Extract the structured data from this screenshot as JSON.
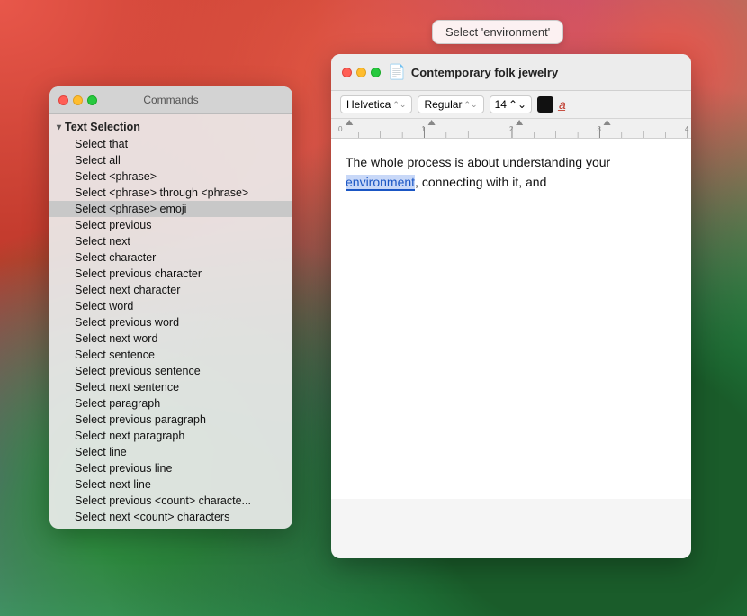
{
  "wallpaper": {},
  "tooltip": {
    "text": "Select 'environment'"
  },
  "commands_panel": {
    "title": "Commands",
    "traffic_lights": {
      "close": "close",
      "minimize": "minimize",
      "maximize": "maximize"
    },
    "section": {
      "label": "Text Selection",
      "chevron": "▾",
      "items": [
        {
          "label": "Select that",
          "highlighted": false
        },
        {
          "label": "Select all",
          "highlighted": false
        },
        {
          "label": "Select <phrase>",
          "highlighted": false
        },
        {
          "label": "Select <phrase> through <phrase>",
          "highlighted": false
        },
        {
          "label": "Select <phrase> emoji",
          "highlighted": true
        },
        {
          "label": "Select previous",
          "highlighted": false
        },
        {
          "label": "Select next",
          "highlighted": false
        },
        {
          "label": "Select character",
          "highlighted": false
        },
        {
          "label": "Select previous character",
          "highlighted": false
        },
        {
          "label": "Select next character",
          "highlighted": false
        },
        {
          "label": "Select word",
          "highlighted": false
        },
        {
          "label": "Select previous word",
          "highlighted": false
        },
        {
          "label": "Select next word",
          "highlighted": false
        },
        {
          "label": "Select sentence",
          "highlighted": false
        },
        {
          "label": "Select previous sentence",
          "highlighted": false
        },
        {
          "label": "Select next sentence",
          "highlighted": false
        },
        {
          "label": "Select paragraph",
          "highlighted": false
        },
        {
          "label": "Select previous paragraph",
          "highlighted": false
        },
        {
          "label": "Select next paragraph",
          "highlighted": false
        },
        {
          "label": "Select line",
          "highlighted": false
        },
        {
          "label": "Select previous line",
          "highlighted": false
        },
        {
          "label": "Select next line",
          "highlighted": false
        },
        {
          "label": "Select previous <count> characte...",
          "highlighted": false
        },
        {
          "label": "Select next <count> characters",
          "highlighted": false
        }
      ]
    }
  },
  "editor": {
    "title": "Contemporary folk jewelry",
    "doc_icon": "📄",
    "toolbar": {
      "font": "Helvetica",
      "style": "Regular",
      "size": "14",
      "font_chevron": "⌄",
      "style_chevron": "⌄",
      "size_chevron": "⌄"
    },
    "content": {
      "text_before": "The whole process is about understanding your ",
      "highlighted_word": "environment",
      "text_after": ", connecting with it, and"
    }
  }
}
